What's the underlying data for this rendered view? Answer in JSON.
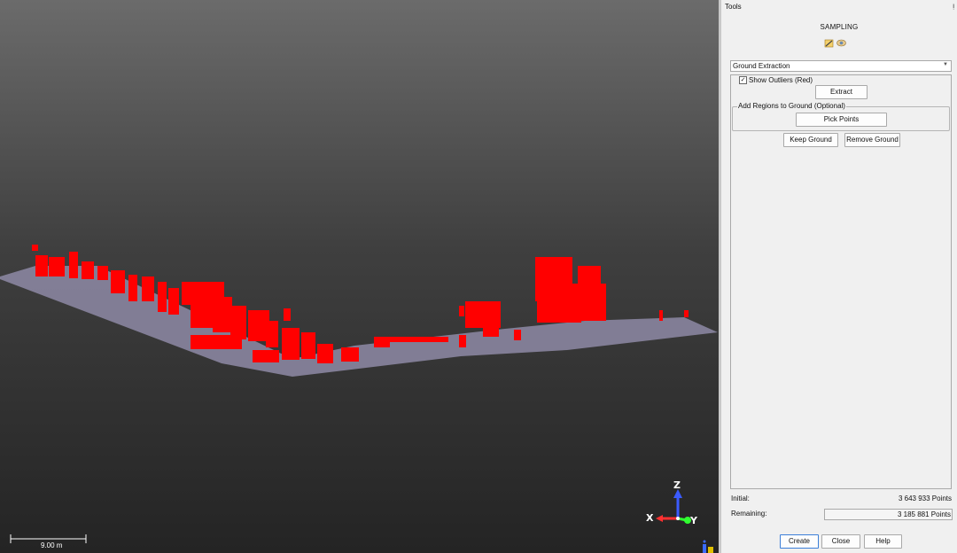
{
  "panel": {
    "title": "Tools",
    "section_title": "SAMPLING",
    "mode_select": "Ground Extraction",
    "show_outliers_label": "Show Outliers (Red)",
    "show_outliers_checked": true,
    "extract_label": "Extract",
    "regions_group_label": "Add Regions to Ground (Optional)",
    "pick_points_label": "Pick Points",
    "keep_ground_label": "Keep Ground",
    "remove_ground_label": "Remove Ground",
    "initial_label": "Initial:",
    "initial_value": "3 643 933  Points",
    "remaining_label": "Remaining:",
    "remaining_value": "3 185 881  Points",
    "create_label": "Create",
    "close_label": "Close",
    "help_label": "Help"
  },
  "viewport": {
    "scale_label": "9.00 m",
    "axis_z": "Z",
    "axis_x": "X",
    "axis_y": "Y",
    "colors": {
      "outliers": "#ff0000",
      "ground": "#8a85a0"
    }
  },
  "icons": [
    "pencil-icon",
    "eye-icon",
    "pin-icon",
    "info-lock-icon"
  ]
}
